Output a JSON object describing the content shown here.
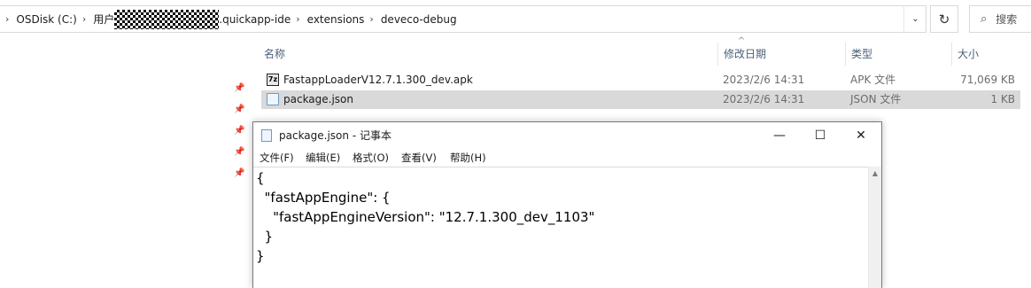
{
  "explorer": {
    "breadcrumb": [
      "OSDisk (C:)",
      "用户",
      ".quickapp-ide",
      "extensions",
      "deveco-debug"
    ],
    "search_placeholder": "搜索",
    "columns": {
      "name": "名称",
      "date": "修改日期",
      "type": "类型",
      "size": "大小"
    },
    "files": [
      {
        "name": "FastappLoaderV12.7.1.300_dev.apk",
        "date": "2023/2/6 14:31",
        "type": "APK 文件",
        "size": "71,069 KB",
        "icon": "apk-archive-icon",
        "icon_glyph": "7z",
        "selected": false
      },
      {
        "name": "package.json",
        "date": "2023/2/6 14:31",
        "type": "JSON 文件",
        "size": "1 KB",
        "icon": "json-file-icon",
        "selected": true
      }
    ]
  },
  "notepad": {
    "title": "package.json - 记事本",
    "menu": [
      "文件(F)",
      "编辑(E)",
      "格式(O)",
      "查看(V)",
      "帮助(H)"
    ],
    "content_lines": [
      "{",
      "  \"fastAppEngine\": {",
      "    \"fastAppEngineVersion\": \"12.7.1.300_dev_1103\"",
      "  }",
      "}"
    ]
  },
  "icons": {
    "refresh": "↻",
    "search": "⌕",
    "minimize": "—",
    "maximize": "☐",
    "close": "✕",
    "pin": "📌",
    "chevron": "›",
    "dropdown": "⌄",
    "sort_up": "^"
  }
}
